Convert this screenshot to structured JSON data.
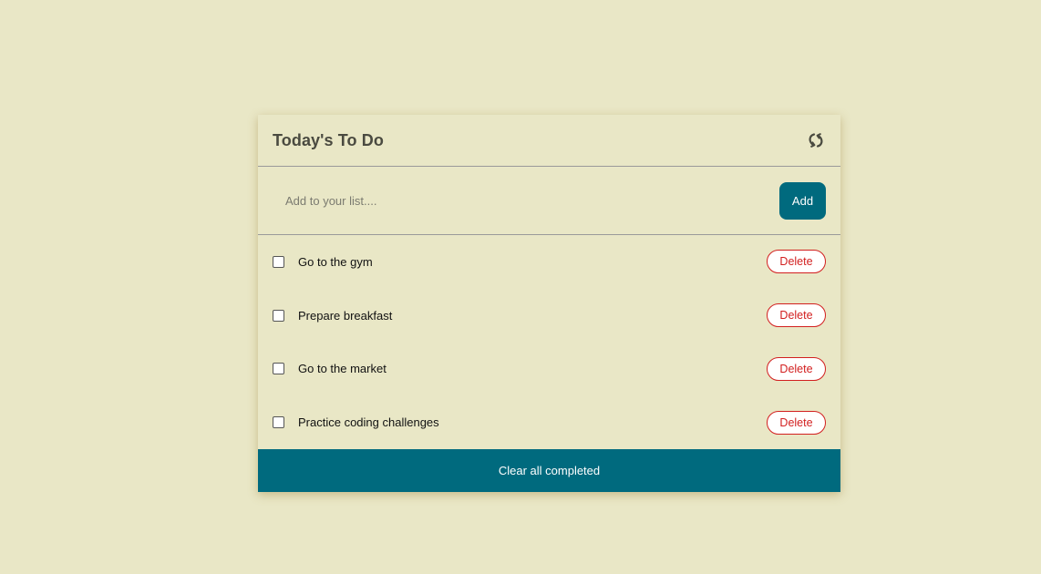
{
  "header": {
    "title": "Today's To Do",
    "refresh_icon": "refresh-icon"
  },
  "add_form": {
    "placeholder": "Add to your list....",
    "value": "",
    "add_label": "Add"
  },
  "todos": [
    {
      "text": "Go to the gym",
      "completed": false,
      "delete_label": "Delete"
    },
    {
      "text": "Prepare breakfast",
      "completed": false,
      "delete_label": "Delete"
    },
    {
      "text": "Go to the market",
      "completed": false,
      "delete_label": "Delete"
    },
    {
      "text": "Practice coding challenges",
      "completed": false,
      "delete_label": "Delete"
    }
  ],
  "footer": {
    "clear_label": "Clear all completed"
  },
  "colors": {
    "background": "#e9e7c6",
    "accent": "#006a7e",
    "danger": "#d21f1f",
    "title": "#4a4a40"
  }
}
